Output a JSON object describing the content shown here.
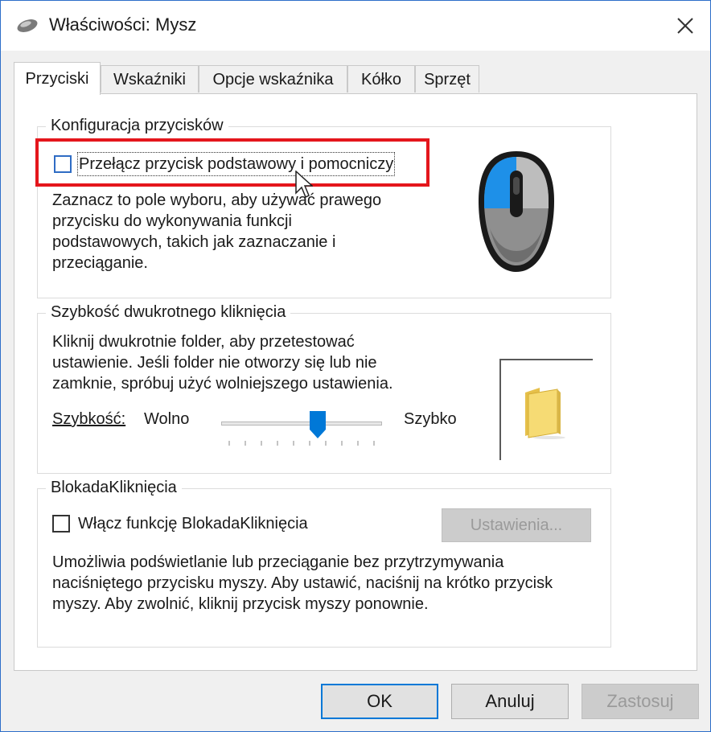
{
  "window": {
    "title": "Właściwości: Mysz"
  },
  "tabs": [
    {
      "label": "Przyciski"
    },
    {
      "label": "Wskaźniki"
    },
    {
      "label": "Opcje wskaźnika"
    },
    {
      "label": "Kółko"
    },
    {
      "label": "Sprzęt"
    }
  ],
  "button_config": {
    "legend": "Konfiguracja przycisków",
    "checkbox_label": "Przełącz przycisk podstawowy i pomocniczy",
    "checked": false,
    "description": [
      "Zaznacz to pole wyboru, aby używać prawego",
      "przycisku do wykonywania funkcji",
      "podstawowych, takich jak zaznaczanie i",
      "przeciąganie."
    ]
  },
  "double_click": {
    "legend": "Szybkość dwukrotnego kliknięcia",
    "description": [
      "Kliknij dwukrotnie folder, aby przetestować",
      "ustawienie. Jeśli folder nie otworzy się lub nie",
      "zamknie, spróbuj użyć wolniejszego ustawienia."
    ],
    "speed_label": "Szybkość:",
    "slow_label": "Wolno",
    "fast_label": "Szybko",
    "slider_value": 0.6
  },
  "click_lock": {
    "legend": "BlokadaKliknięcia",
    "checkbox_label": "Włącz funkcję BlokadaKliknięcia",
    "checked": false,
    "settings_button": "Ustawienia...",
    "description": [
      "Umożliwia podświetlanie lub przeciąganie bez przytrzymywania",
      "naciśniętego przycisku myszy. Aby ustawić, naciśnij na krótko przycisk",
      "myszy. Aby zwolnić, kliknij przycisk myszy ponownie."
    ]
  },
  "footer": {
    "ok": "OK",
    "cancel": "Anuluj",
    "apply": "Zastosuj"
  },
  "colors": {
    "accent": "#0078d7",
    "highlight": "#e4161c",
    "mouse_button": "#1e90e8"
  }
}
